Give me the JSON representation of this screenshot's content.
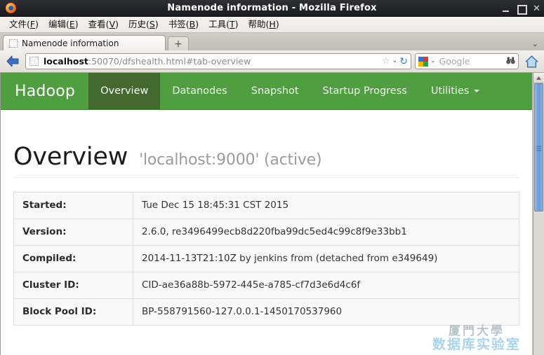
{
  "window": {
    "title": "Namenode information - Mozilla Firefox",
    "app_icon": "firefox-logo-icon",
    "minimize_label": "_",
    "maximize_label": "□",
    "close_label": "✕"
  },
  "menubar": {
    "items": [
      {
        "name": "file",
        "text": "文件(",
        "accel": "F",
        "tail": ")"
      },
      {
        "name": "edit",
        "text": "编辑(",
        "accel": "E",
        "tail": ")"
      },
      {
        "name": "view",
        "text": "查看(",
        "accel": "V",
        "tail": ")"
      },
      {
        "name": "history",
        "text": "历史(",
        "accel": "S",
        "tail": ")"
      },
      {
        "name": "bookmarks",
        "text": "书签(",
        "accel": "B",
        "tail": ")"
      },
      {
        "name": "tools",
        "text": "工具(",
        "accel": "T",
        "tail": ")"
      },
      {
        "name": "help",
        "text": "帮助(",
        "accel": "H",
        "tail": ")"
      }
    ]
  },
  "tabstrip": {
    "tabs": [
      {
        "label": "Namenode information",
        "active": true
      }
    ],
    "new_tab_label": "+",
    "list_all_tabs_caret": "⌄"
  },
  "toolbar": {
    "back_label": "◀",
    "url_bold": "localhost",
    "url_rest": ":50070/dfshealth.html#tab-overview",
    "url_full": "localhost:50070/dfshealth.html#tab-overview",
    "bookmark_star": "☆",
    "dropmarker": "⌄",
    "reload": "↻",
    "search_engine": "Google",
    "search_placeholder": "Google",
    "search_value": "",
    "binoculars": "⚇⚇",
    "home_label": "home"
  },
  "hadoop": {
    "brand": "Hadoop",
    "nav": [
      {
        "label": "Overview",
        "active": true,
        "caret": false
      },
      {
        "label": "Datanodes",
        "active": false,
        "caret": false
      },
      {
        "label": "Snapshot",
        "active": false,
        "caret": false
      },
      {
        "label": "Startup Progress",
        "active": false,
        "caret": false
      },
      {
        "label": "Utilities",
        "active": false,
        "caret": true
      }
    ],
    "colors": {
      "nav_bg": "#4f9e3f",
      "nav_active_bg": "#44692f",
      "nav_text": "#ffffff"
    }
  },
  "overview": {
    "heading": "Overview",
    "subheading": "'localhost:9000' (active)",
    "rows": [
      {
        "label": "Started:",
        "value": "Tue Dec 15 18:45:31 CST 2015"
      },
      {
        "label": "Version:",
        "value": "2.6.0, re3496499ecb8d220fba99dc5ed4c99c8f9e33bb1"
      },
      {
        "label": "Compiled:",
        "value": "2014-11-13T21:10Z by jenkins from (detached from e349649)"
      },
      {
        "label": "Cluster ID:",
        "value": "CID-ae36a88b-5972-445e-a785-cf7d3e6d4c6f"
      },
      {
        "label": "Block Pool ID:",
        "value": "BP-558791560-127.0.0.1-1450170537960"
      }
    ]
  },
  "watermark": {
    "line1": "厦門大學",
    "line2": "数据库实验室"
  },
  "scrollbar": {
    "up_arrow": "▲",
    "position": "top"
  }
}
